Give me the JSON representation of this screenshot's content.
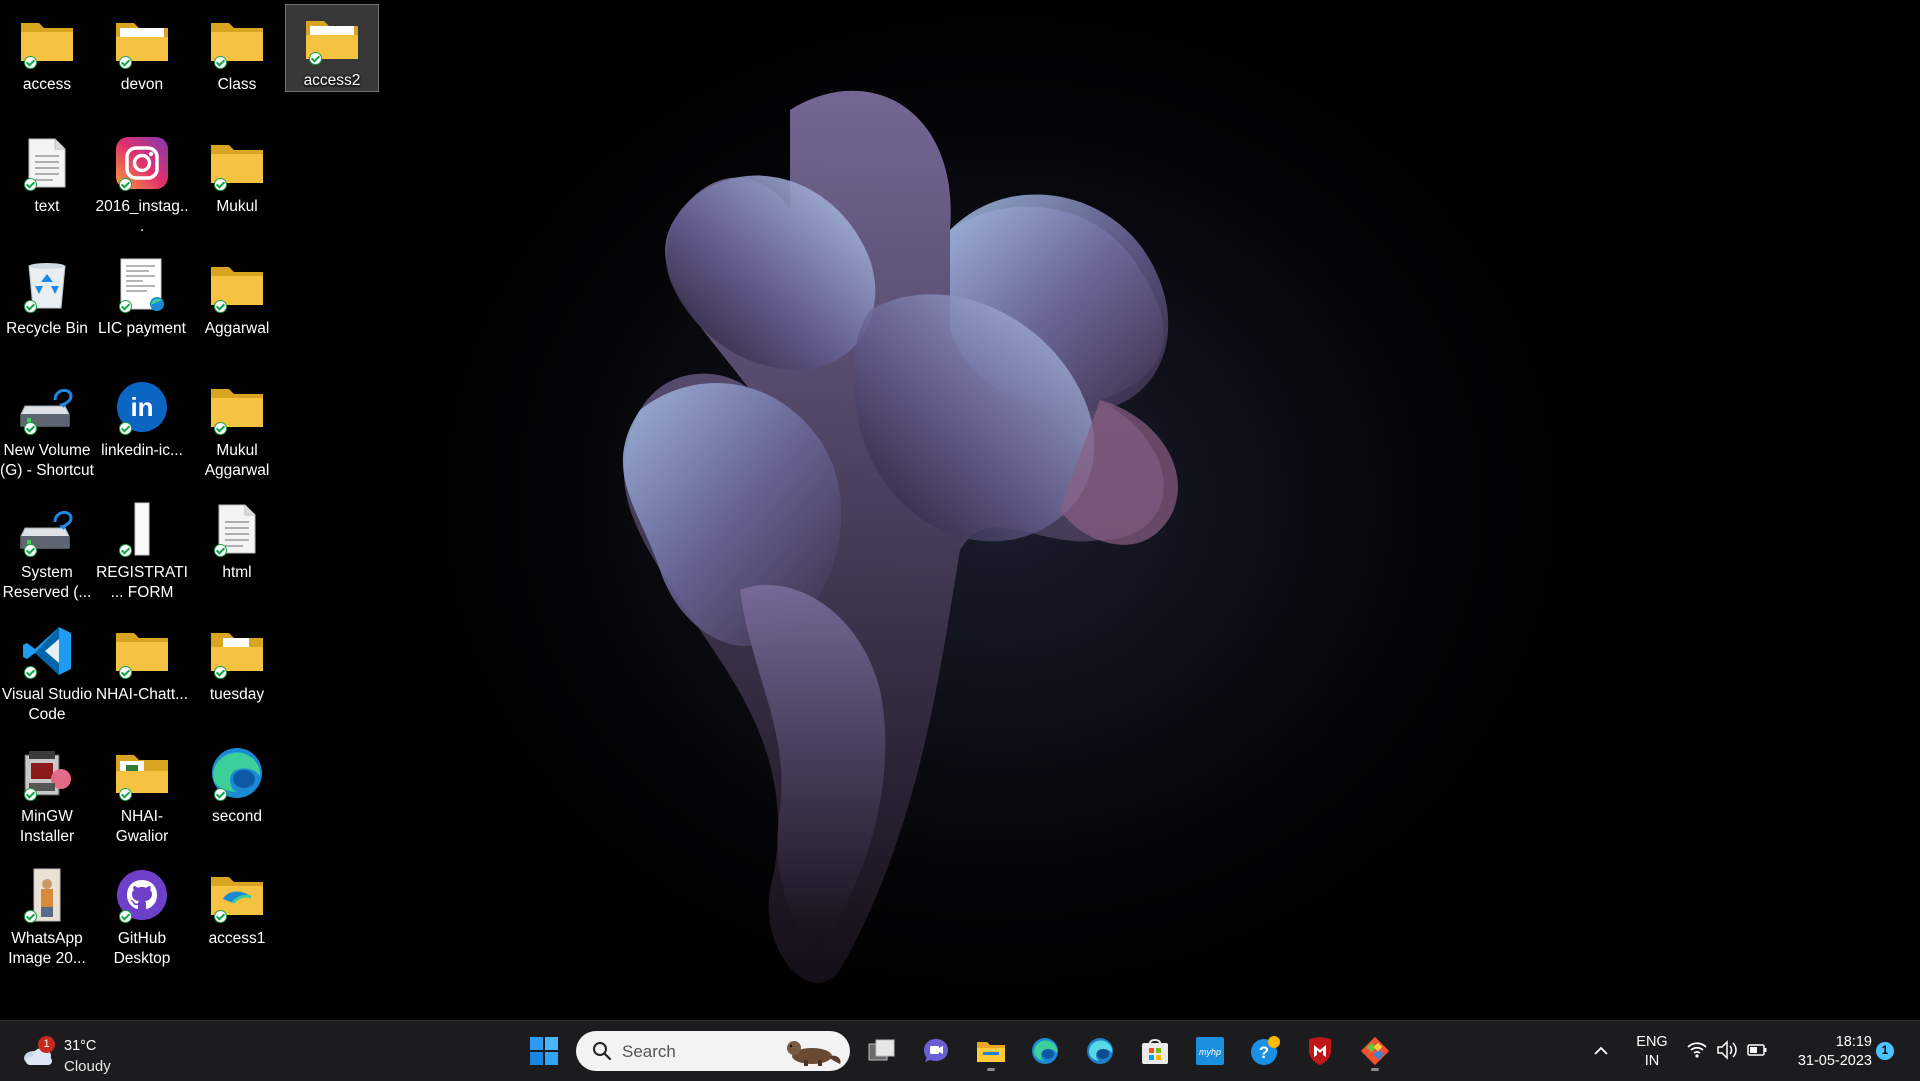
{
  "desktop": {
    "icons": [
      {
        "label": "access",
        "icon": "folder-icon"
      },
      {
        "label": "devon",
        "icon": "folder-icon"
      },
      {
        "label": "Class",
        "icon": "folder-icon"
      },
      {
        "label": "access2",
        "icon": "folder-icon",
        "selected": true
      },
      {
        "label": "text",
        "icon": "text-file-icon"
      },
      {
        "label": "2016_instag...",
        "icon": "instagram-icon"
      },
      {
        "label": "Mukul",
        "icon": "folder-icon"
      },
      {
        "label": "Recycle Bin",
        "icon": "recycle-bin-icon"
      },
      {
        "label": "LIC payment",
        "icon": "document-icon"
      },
      {
        "label": "Aggarwal",
        "icon": "folder-icon"
      },
      {
        "label": "New Volume (G) - Shortcut",
        "icon": "drive-shortcut-icon"
      },
      {
        "label": "linkedin-ic...",
        "icon": "linkedin-icon"
      },
      {
        "label": "Mukul Aggarwal",
        "icon": "folder-icon"
      },
      {
        "label": "System Reserved (...",
        "icon": "drive-shortcut-icon"
      },
      {
        "label": "REGISTRATI... FORM",
        "icon": "form-file-icon"
      },
      {
        "label": "html",
        "icon": "text-file-icon"
      },
      {
        "label": "Visual Studio Code",
        "icon": "vscode-icon"
      },
      {
        "label": "NHAI-Chatt...",
        "icon": "folder-icon"
      },
      {
        "label": "tuesday",
        "icon": "folder-icon"
      },
      {
        "label": "MinGW Installer",
        "icon": "installer-icon"
      },
      {
        "label": "NHAI-Gwalior",
        "icon": "folder-icon"
      },
      {
        "label": "second",
        "icon": "edge-icon"
      },
      {
        "label": "WhatsApp Image 20...",
        "icon": "image-file-icon"
      },
      {
        "label": "GitHub Desktop",
        "icon": "github-icon"
      },
      {
        "label": "access1",
        "icon": "folder-icon"
      }
    ]
  },
  "taskbar": {
    "weather": {
      "temp": "31°C",
      "condition": "Cloudy",
      "badge": "1"
    },
    "search": {
      "placeholder": "Search"
    },
    "apps": [
      {
        "name": "start-button-icon"
      },
      {
        "name": "task-view-icon"
      },
      {
        "name": "teams-chat-icon"
      },
      {
        "name": "file-explorer-icon",
        "running": true
      },
      {
        "name": "edge-icon"
      },
      {
        "name": "edge-beta-icon"
      },
      {
        "name": "microsoft-store-icon"
      },
      {
        "name": "myhp-icon"
      },
      {
        "name": "help-icon"
      },
      {
        "name": "mcafee-icon"
      },
      {
        "name": "git-gui-icon",
        "running": true
      }
    ],
    "myhp_text": "myhp",
    "language": {
      "line1": "ENG",
      "line2": "IN"
    },
    "clock": {
      "time": "18:19",
      "date": "31-05-2023"
    },
    "notification_count": "1"
  },
  "colors": {
    "folder": "#f5c242",
    "taskbar_bg": "#1c1c1e",
    "accent": "#4cc2ff"
  }
}
